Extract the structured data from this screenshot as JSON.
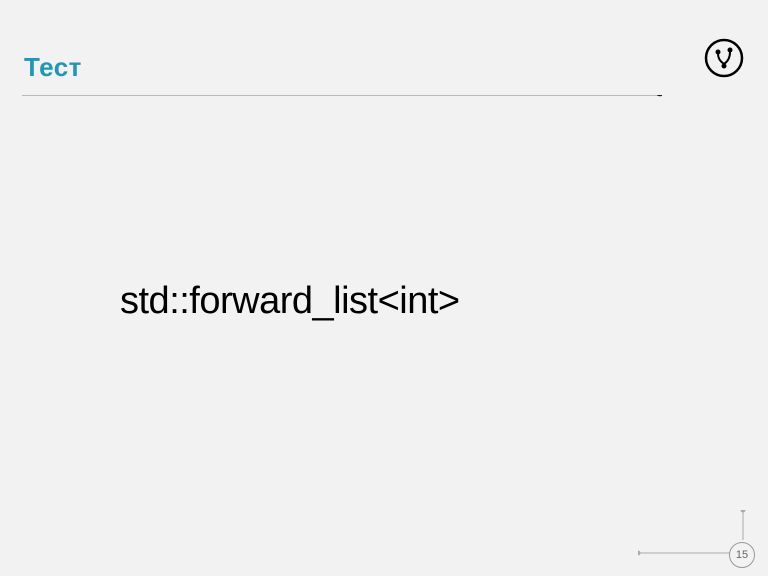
{
  "header": {
    "title": "Тест"
  },
  "content": {
    "main_text": "std::forward_list<int>"
  },
  "footer": {
    "page_number": "15"
  },
  "icons": {
    "header_icon": "git-branch-icon"
  },
  "colors": {
    "title_color": "#2296b5",
    "text_color": "#000000",
    "background": "#f2f2f2"
  }
}
